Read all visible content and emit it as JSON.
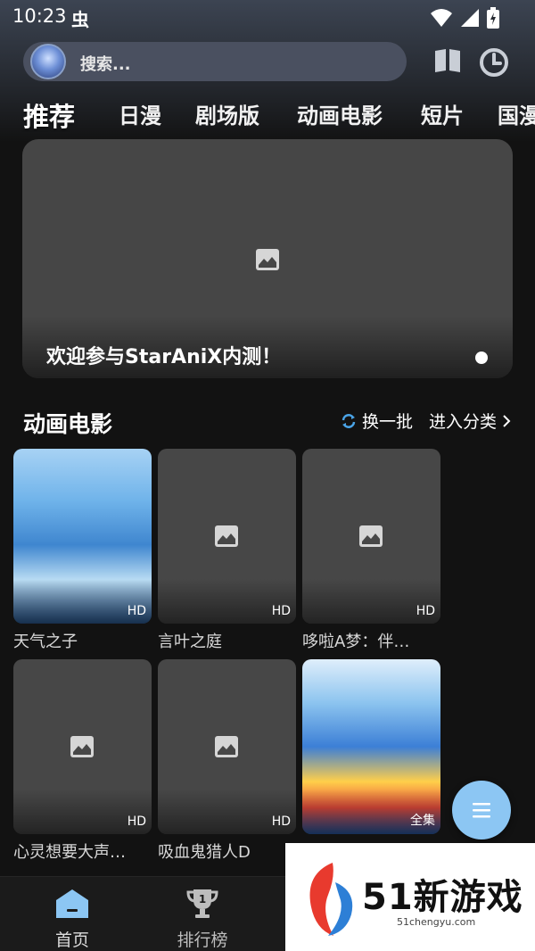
{
  "status_bar": {
    "time": "10:23",
    "extra_glyph": "虫"
  },
  "search": {
    "placeholder": "搜索..."
  },
  "tabs": [
    {
      "label": "推荐",
      "active": true
    },
    {
      "label": "日漫"
    },
    {
      "label": "剧场版"
    },
    {
      "label": "动画电影"
    },
    {
      "label": "短片"
    },
    {
      "label": "国漫"
    }
  ],
  "banner": {
    "caption": "欢迎参与StarAniX内测！"
  },
  "section": {
    "title": "动画电影",
    "refresh_label": "换一批",
    "enter_label": "进入分类"
  },
  "cards": [
    {
      "title": "天气之子",
      "badge": "HD",
      "art": "weather"
    },
    {
      "title": "言叶之庭",
      "badge": "HD",
      "art": "placeholder"
    },
    {
      "title": "哆啦A梦：伴…",
      "badge": "HD",
      "art": "placeholder"
    },
    {
      "title": "心灵想要大声…",
      "badge": "HD",
      "art": "placeholder"
    },
    {
      "title": "吸血鬼猎人D",
      "badge": "HD",
      "art": "placeholder"
    },
    {
      "title": "",
      "badge": "全集",
      "art": "doraemon"
    }
  ],
  "bottom_nav": [
    {
      "label": "首页",
      "active": true
    },
    {
      "label": "排行榜",
      "active": false,
      "icon_number": "1"
    }
  ],
  "watermark": {
    "text": "51新游戏",
    "subtext": "51chengyu.com"
  },
  "colors": {
    "accent": "#8cc6f3",
    "background": "#121212",
    "card_placeholder": "#474747"
  }
}
